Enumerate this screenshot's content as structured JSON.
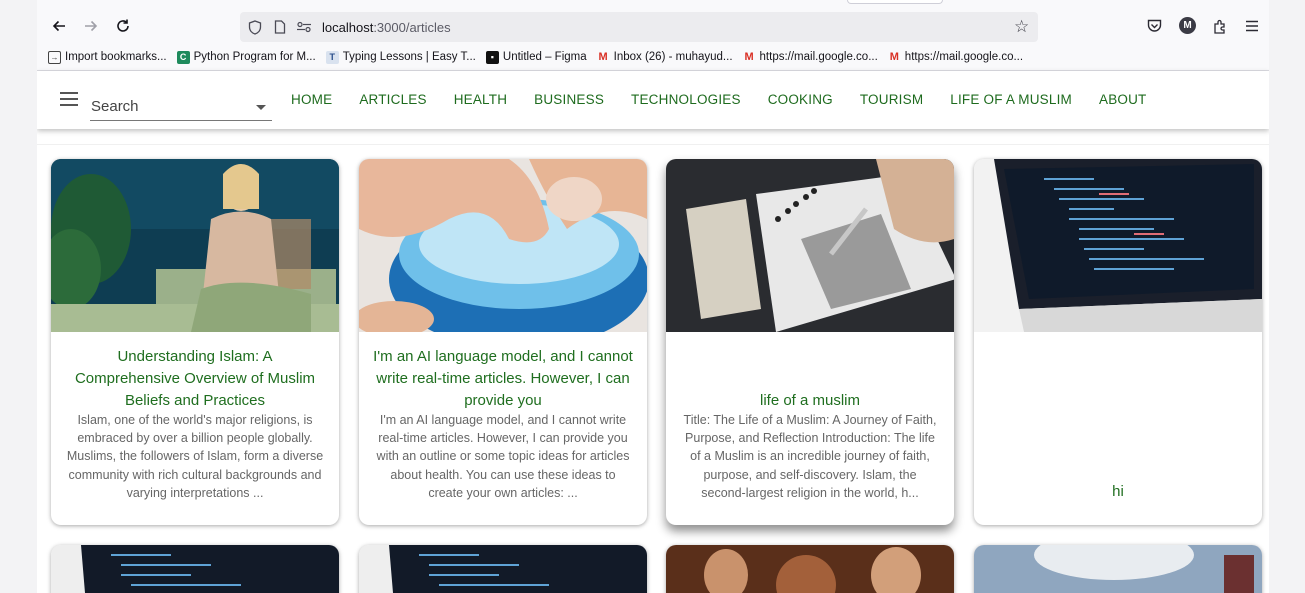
{
  "browser": {
    "url_host": "localhost",
    "url_path": ":3000/articles",
    "bookmarks": [
      {
        "label": "Import bookmarks...",
        "icon": "import-icon"
      },
      {
        "label": "Python Program for M...",
        "icon": "c-logo-icon"
      },
      {
        "label": "Typing Lessons | Easy T...",
        "icon": "t-logo-icon"
      },
      {
        "label": "Untitled – Figma",
        "icon": "figma-icon"
      },
      {
        "label": "Inbox (26) - muhayud...",
        "icon": "gmail-icon"
      },
      {
        "label": "https://mail.google.co...",
        "icon": "gmail-icon"
      },
      {
        "label": "https://mail.google.co...",
        "icon": "gmail-icon"
      }
    ],
    "profile_initial": "M"
  },
  "header": {
    "search_label": "Search",
    "menu": [
      "HOME",
      "ARTICLES",
      "HEALTH",
      "BUSINESS",
      "TECHNOLOGIES",
      "COOKING",
      "TOURISM",
      "LIFE OF A MUSLIM",
      "ABOUT"
    ]
  },
  "cards": [
    {
      "title": "Understanding Islam: A Comprehensive Overview of Muslim Beliefs and Practices",
      "description": "Islam, one of the world's major religions, is embraced by over a billion people globally. Muslims, the followers of Islam, form a diverse community with rich cultural backgrounds and varying interpretations ..."
    },
    {
      "title": "I'm an AI language model, and I cannot write real-time articles. However, I can provide you",
      "description": "I'm an AI language model, and I cannot write real-time articles. However, I can provide you with an outline or some topic ideas for articles about health. You can use these ideas to create your own articles: ..."
    },
    {
      "title": "life of a muslim",
      "description": "Title: The Life of a Muslim: A Journey of Faith, Purpose, and Reflection Introduction: The life of a Muslim is an incredible journey of faith, purpose, and self-discovery. Islam, the second-largest religion in the world, h..."
    },
    {
      "title": "hi",
      "description": ""
    }
  ],
  "colors": {
    "accent_green": "#1e6b1e",
    "browser_chrome": "#f9f9fb"
  }
}
